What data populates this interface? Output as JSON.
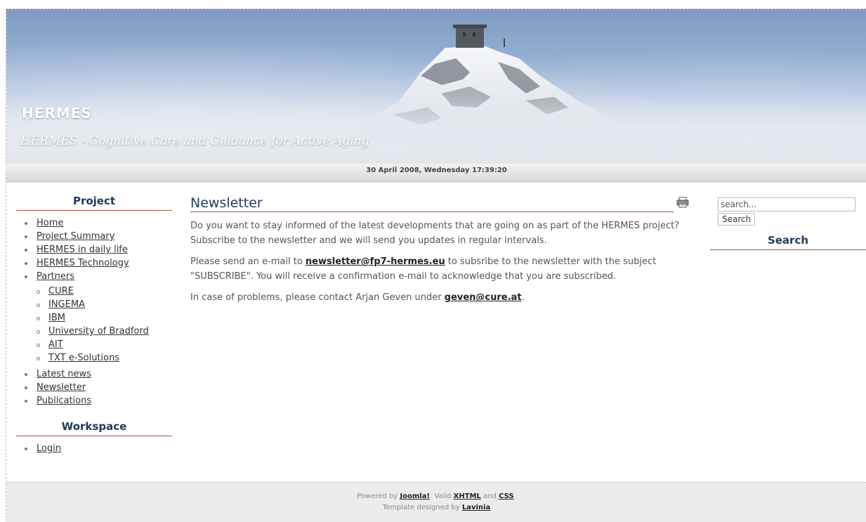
{
  "header": {
    "site_title": "HERMES",
    "site_slogan": "HERMES - Cognitive Care and Guidance for Active Aging"
  },
  "datebar": {
    "datetime": "30 April 2008, Wednesday 17:39:20"
  },
  "left": {
    "project_title": "Project",
    "menu": {
      "home": "Home",
      "project_summary": "Project Summary",
      "daily_life": "HERMES in daily life",
      "technology": "HERMES Technology",
      "partners": "Partners",
      "cure": "CURE",
      "ingema": "INGEMA",
      "ibm": "IBM",
      "bradford": "University of Bradford",
      "ait": "AIT",
      "txt": "TXT e-Solutions",
      "latest_news": "Latest news",
      "newsletter": "Newsletter",
      "publications": "Publications"
    },
    "workspace_title": "Workspace",
    "login": "Login"
  },
  "article": {
    "title": "Newsletter",
    "p1": "Do you want to stay informed of the latest developments that are going on as part of the HERMES project? Subscribe to the newsletter and we will send you updates in regular intervals.",
    "p2_before": "Please send an e-mail to ",
    "p2_email": "newsletter@fp7-hermes.eu",
    "p2_after": " to subsribe to the newsletter with the subject \"SUBSCRIBE\". You will receive a confirmation e-mail to acknowledge that you are subscribed.",
    "p3_before": "In case of problems, please contact Arjan Geven under ",
    "p3_email": "geven@cure.at",
    "p3_after": "."
  },
  "search": {
    "placeholder": "search...",
    "button": "Search",
    "title": "Search"
  },
  "footer": {
    "powered_by": "Powered by ",
    "joomla": "Joomla!",
    "valid": ". Valid ",
    "xhtml": "XHTML",
    "and": " and ",
    "css": "CSS",
    "dot": ".",
    "template_by": "Template designed by ",
    "lavinia": "Lavinia"
  }
}
